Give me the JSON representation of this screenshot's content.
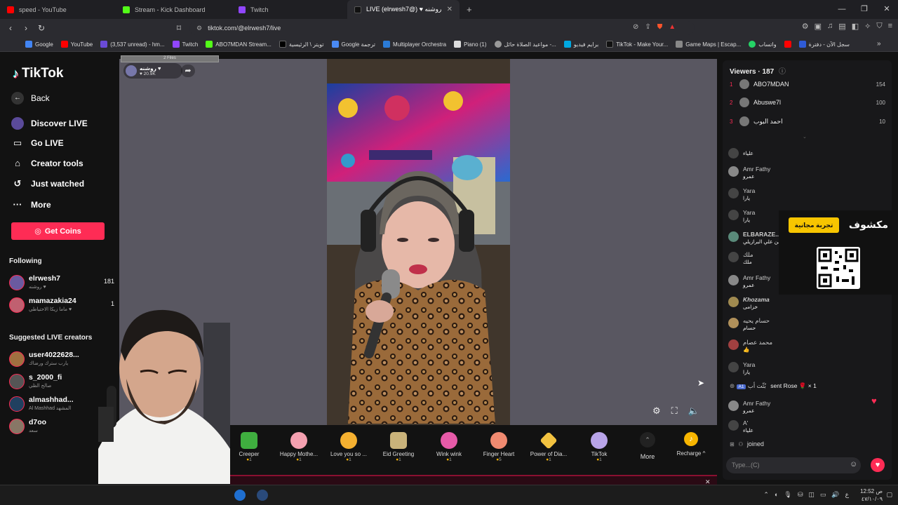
{
  "browser": {
    "tabs": [
      {
        "label": "speed - YouTube",
        "color": "#ff0000"
      },
      {
        "label": "Stream - Kick Dashboard",
        "color": "#53fc18"
      },
      {
        "label": "Twitch",
        "color": "#9146ff"
      },
      {
        "label": "LIVE (elrwesh7@) ♥ روشنه",
        "color": "#fe2c55"
      }
    ],
    "new_tab": "+",
    "url": "tiktok.com/@elrwesh7/live",
    "bookmarks": [
      "Google",
      "YouTube",
      "(3,537 unread) - hm...",
      "Twitch",
      "ABO7MDAN Stream...",
      "تويتر \\ الرئيسية",
      "Google ترجمة",
      "Multiplayer Orchestra",
      "Piano (1)",
      "مواعيد الصلاة حائل -...",
      "برايم فيديو",
      "TikTok - Make Your...",
      "Game Maps | Escap...",
      "واتساب",
      "سجل الآن - دفترة"
    ]
  },
  "sidebar": {
    "logo": "TikTok",
    "back": "Back",
    "nav": [
      "Discover LIVE",
      "Go LIVE",
      "Creator tools",
      "Just watched",
      "More"
    ],
    "get_coins": "Get Coins",
    "following_title": "Following",
    "following": [
      {
        "name": "elrwesh7",
        "sub": "روشنه ♥",
        "count": "181"
      },
      {
        "name": "mamazakia24",
        "sub": "ماما زيكا الاحتياطي ♥",
        "count": "1"
      }
    ],
    "suggested_title": "Suggested LIVE creators",
    "suggested": [
      {
        "name": "user4022628...",
        "sub": "يارب سترك ورضاك"
      },
      {
        "name": "s_2000_fi",
        "sub": "صالح الظي"
      },
      {
        "name": "almashhad...",
        "sub": "Al Mashhad المشهد"
      },
      {
        "name": "d7oo",
        "sub": "سعد"
      }
    ]
  },
  "stream": {
    "host_name": "روشنه ♥",
    "host_likes": "♥ 20.9K",
    "files_label": "2 Files"
  },
  "gifts": [
    {
      "name": "Creeper",
      "price": "1"
    },
    {
      "name": "Happy Mothe...",
      "price": "1"
    },
    {
      "name": "Love you so ...",
      "price": "1"
    },
    {
      "name": "Eid Greeting",
      "price": "1"
    },
    {
      "name": "Wink wink",
      "price": "1"
    },
    {
      "name": "Finger Heart",
      "price": "5"
    },
    {
      "name": "Power of Dia...",
      "price": "1"
    },
    {
      "name": "TikTok",
      "price": "1"
    }
  ],
  "more_label": "More",
  "recharge_label": "Recharge ^",
  "viewers": {
    "title": "Viewers · 187",
    "list": [
      {
        "rank": "1",
        "name": "ABO7MDAN",
        "score": "154"
      },
      {
        "rank": "2",
        "name": "Abuswe7l",
        "score": "100"
      },
      {
        "rank": "3",
        "name": "احمد البوب",
        "score": "10"
      }
    ]
  },
  "chat": [
    {
      "name": "",
      "text": "علياء"
    },
    {
      "name": "Amr Fathy",
      "text": "عمرو"
    },
    {
      "name": "Yara",
      "text": "يارا"
    },
    {
      "name": "Yara",
      "text": "يارا"
    },
    {
      "name": "ELBARAZE...",
      "text": "حسن علي البرازيلي"
    },
    {
      "name": "ملك",
      "text": "ملك"
    },
    {
      "name": "Amr Fathy",
      "text": "عمرو"
    },
    {
      "name": "Khozama",
      "text": "خزامى"
    },
    {
      "name": "حسام يحيه",
      "text": "حسام"
    },
    {
      "name": "محمد عصام",
      "text": "👍"
    },
    {
      "name": "Yara",
      "text": "يارا"
    }
  ],
  "rose_event": {
    "name": "بُثّت أب",
    "text": "sent Rose 🌹 × 1"
  },
  "chat_after": [
    {
      "name": "Amr Fathy",
      "text": "عمرو"
    },
    {
      "name": "A'",
      "text": "علياء"
    }
  ],
  "joined": "joined",
  "ad": {
    "button": "تجربة مجانية",
    "title": "مكشوف"
  },
  "input_placeholder": "Type...(C)",
  "clock": {
    "time": "12:52 ص",
    "date": "٤٧/١٠/٠٩"
  }
}
